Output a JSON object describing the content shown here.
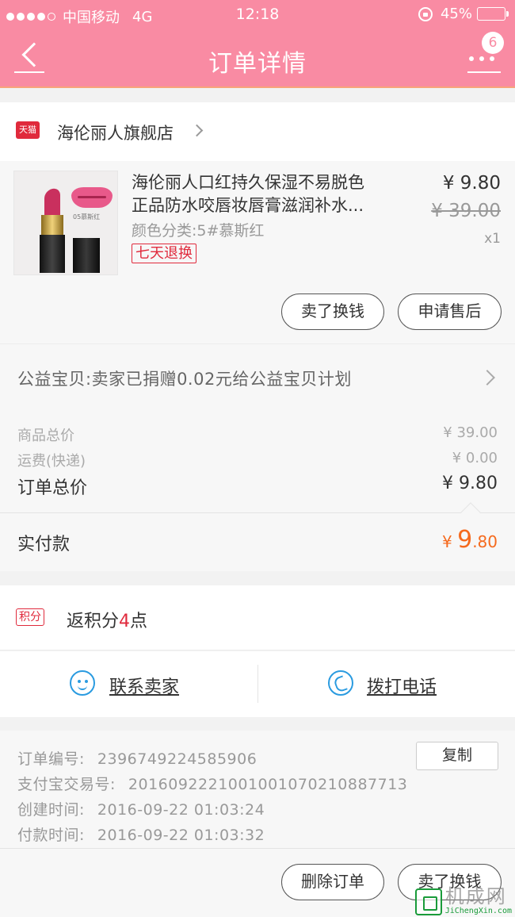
{
  "status_bar": {
    "carrier": "中国移动",
    "network": "4G",
    "time": "12:18",
    "battery_text": "45%",
    "battery_level": 0.45,
    "signal_bars": 4,
    "signal_total": 5
  },
  "nav": {
    "title": "订单详情",
    "badge_count": "6",
    "back_icon": "chevron-left-icon",
    "more_icon": "more-dots-icon"
  },
  "store": {
    "platform_badge": "天猫",
    "name": "海伦丽人旗舰店"
  },
  "product": {
    "title_line1": "海伦丽人口红持久保湿不易脱色",
    "title_line2": "正品防水咬唇妆唇膏滋润补水...",
    "sku": "颜色分类:5#慕斯红",
    "tag": "七天退换",
    "price": "¥ 9.80",
    "original_price": "¥ 39.00",
    "quantity": "x1",
    "thumb_label": "05慕斯红",
    "actions": [
      "卖了换钱",
      "申请售后"
    ]
  },
  "charity": {
    "text": "公益宝贝:卖家已捐赠0.02元给公益宝贝计划"
  },
  "summary": {
    "goods_total_label": "商品总价",
    "goods_total_value": "¥ 39.00",
    "shipping_label": "运费(快递)",
    "shipping_value": "¥ 0.00",
    "order_total_label": "订单总价",
    "order_total_value": "¥ 9.80"
  },
  "paid": {
    "label": "实付款",
    "currency": "¥ ",
    "integer": "9",
    "decimal": ".80"
  },
  "points": {
    "tag": "积分",
    "prefix": "返积分",
    "value": "4",
    "suffix": "点"
  },
  "contact": {
    "seller_label": "联系卖家",
    "call_label": "拨打电话"
  },
  "order_info": {
    "copy_label": "复制",
    "rows": [
      {
        "label": "订单编号:",
        "value": "2396749224585906"
      },
      {
        "label": "支付宝交易号:",
        "value": "2016092221001001070210887713"
      },
      {
        "label": "创建时间:",
        "value": "2016-09-22 01:03:24"
      },
      {
        "label": "付款时间:",
        "value": "2016-09-22 01:03:32"
      }
    ]
  },
  "bottom_actions": [
    "删除订单",
    "卖了换钱"
  ],
  "watermark": {
    "big": "机成网",
    "small": "JiChengXin.com"
  },
  "colors": {
    "brand_pink": "#f98ba3",
    "accent_red": "#e02a3c",
    "paid_orange": "#f56a1e",
    "link_blue": "#2a9be0"
  }
}
